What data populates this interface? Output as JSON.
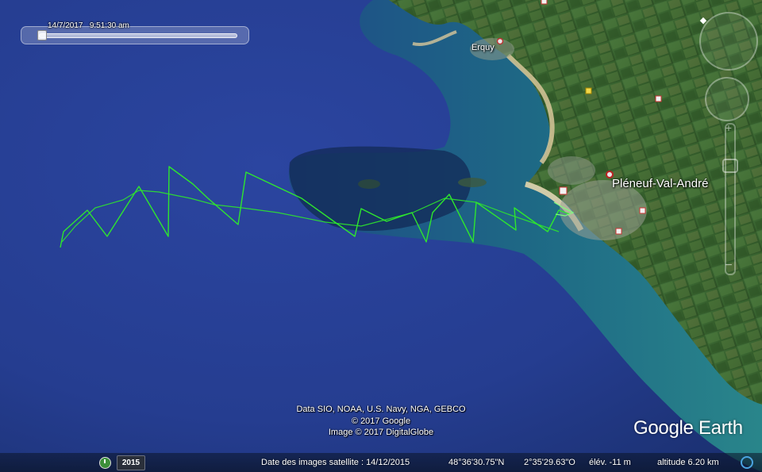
{
  "timeline": {
    "date": "14/7/2017",
    "time": "9:51:30 am"
  },
  "places": {
    "erquy": "Erquy",
    "pleneuf": "Pléneuf-Val-André"
  },
  "attribution": {
    "line1": "Data SIO, NOAA, U.S. Navy, NGA, GEBCO",
    "line2": "© 2017 Google",
    "line3": "Image © 2017 DigitalGlobe"
  },
  "logo": {
    "text": "Google Earth"
  },
  "status": {
    "year": "2015",
    "imagery_date": "Date des images satellite : 14/12/2015",
    "latitude": "48°36'30.75\"N",
    "longitude": "2°35'29.63\"O",
    "elevation": "élév.  -11 m",
    "altitude": "altitude   6.20 km"
  },
  "track": {
    "color": "#2ee62e"
  },
  "colors": {
    "ocean_deep": "#20378a",
    "ocean_shallow": "#1f6f82",
    "land": "#3f6b33"
  },
  "icons": {
    "north": "north-arrow-icon",
    "history": "historical-imagery-icon",
    "status": "streaming-globe-icon"
  }
}
